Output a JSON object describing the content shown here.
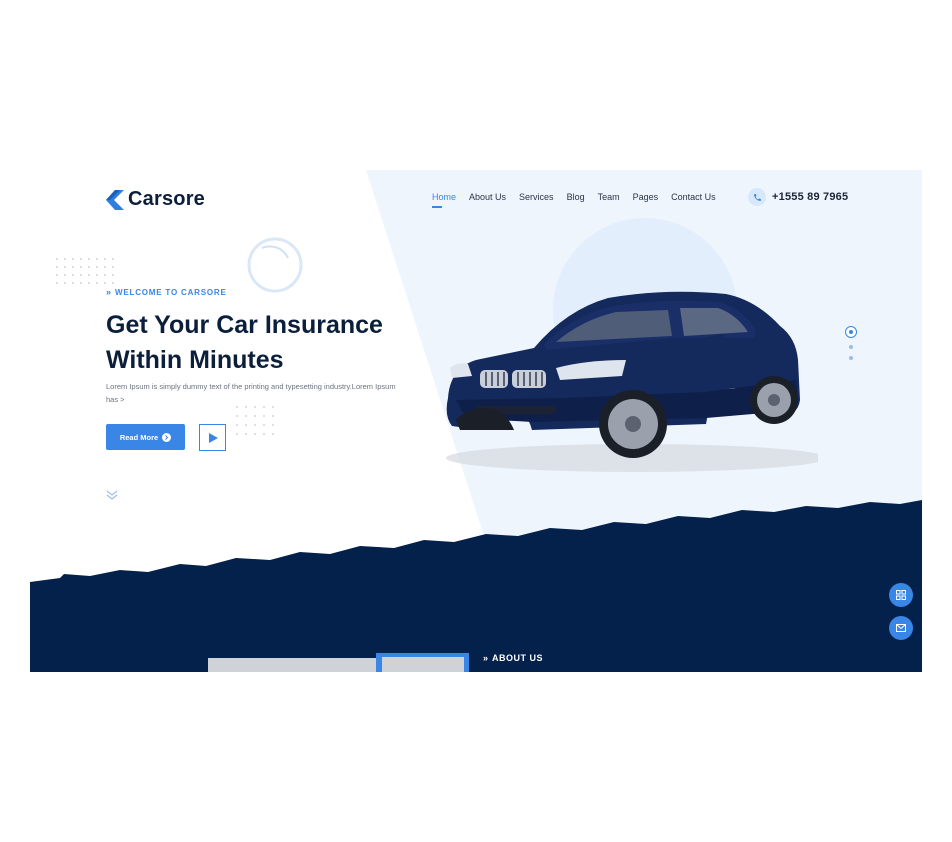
{
  "brand": {
    "name": "Carsore"
  },
  "nav": {
    "items": [
      "Home",
      "About Us",
      "Services",
      "Blog",
      "Team",
      "Pages",
      "Contact Us"
    ],
    "active": "Home"
  },
  "contact": {
    "phone": "+1555 89 7965",
    "icon": "phone-icon"
  },
  "hero": {
    "eyebrow": "WELCOME TO CARSORE",
    "headline_line1": "Get Your Car Insurance",
    "headline_line2": "Within Minutes",
    "description": "Lorem Ipsum is simply dummy text of the printing and typesetting industry.Lorem Ipsum has >",
    "cta_label": "Read More",
    "play_icon": "play-icon"
  },
  "about": {
    "label": "ABOUT US"
  },
  "colors": {
    "accent": "#3a86e6",
    "navy": "#03214a",
    "heading": "#0b1f3b",
    "panel": "#eef5fd"
  },
  "floating_icons": [
    "grid-icon",
    "mail-icon"
  ]
}
